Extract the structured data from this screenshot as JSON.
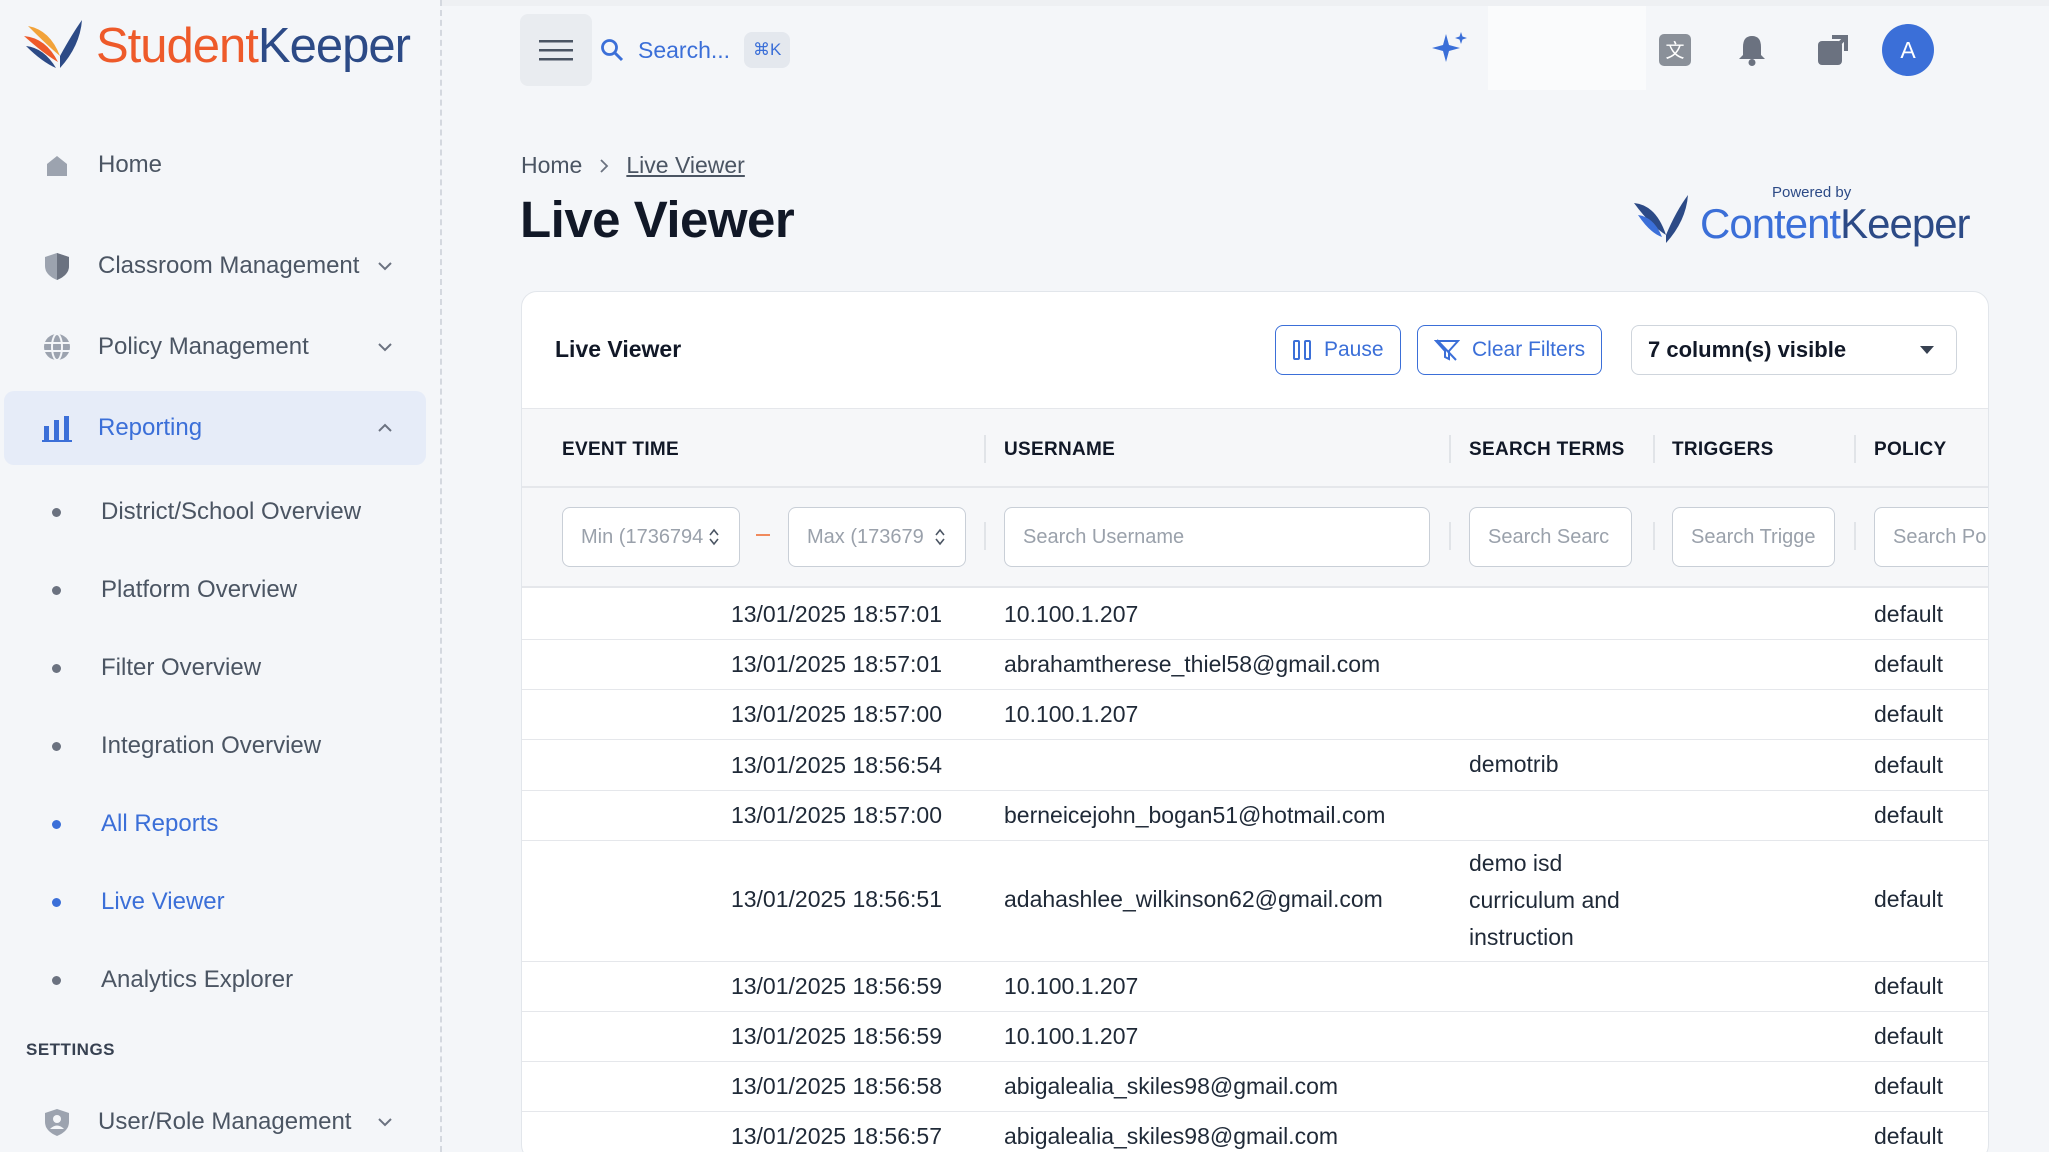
{
  "brand": {
    "logo_part1": "Student",
    "logo_part2": "Keeper"
  },
  "sidebar": {
    "items": [
      {
        "label": "Home"
      },
      {
        "label": "Classroom Management"
      },
      {
        "label": "Policy Management"
      },
      {
        "label": "Reporting"
      }
    ],
    "reporting_sub": [
      {
        "label": "District/School Overview"
      },
      {
        "label": "Platform Overview"
      },
      {
        "label": "Filter Overview"
      },
      {
        "label": "Integration Overview"
      },
      {
        "label": "All Reports"
      },
      {
        "label": "Live Viewer"
      },
      {
        "label": "Analytics Explorer"
      }
    ],
    "settings_label": "SETTINGS",
    "settings_items": [
      {
        "label": "User/Role Management"
      }
    ]
  },
  "topbar": {
    "search_placeholder": "Search...",
    "shortcut": "⌘K",
    "avatar_initial": "A"
  },
  "breadcrumb": {
    "home": "Home",
    "current": "Live Viewer"
  },
  "page_title": "Live Viewer",
  "partner_logo": {
    "powered_by": "Powered by",
    "name_part1": "Content",
    "name_part2": "Keeper"
  },
  "card": {
    "title": "Live Viewer",
    "pause_label": "Pause",
    "clear_filters_label": "Clear Filters",
    "columns_visible": "7 column(s) visible"
  },
  "table": {
    "headers": {
      "event_time": "EVENT TIME",
      "username": "USERNAME",
      "search_terms": "SEARCH TERMS",
      "triggers": "TRIGGERS",
      "policy": "POLICY"
    },
    "filters": {
      "min_placeholder": "Min (1736794",
      "max_placeholder": "Max (173679",
      "username_placeholder": "Search Username",
      "search_terms_placeholder": "Search Searc",
      "triggers_placeholder": "Search Trigge",
      "policy_placeholder": "Search Po"
    },
    "rows": [
      {
        "time": "13/01/2025 18:57:01",
        "username": "10.100.1.207",
        "search_terms": "",
        "policy": "default"
      },
      {
        "time": "13/01/2025 18:57:01",
        "username": "abrahamtherese_thiel58@gmail.com",
        "search_terms": "",
        "policy": "default"
      },
      {
        "time": "13/01/2025 18:57:00",
        "username": "10.100.1.207",
        "search_terms": "",
        "policy": "default"
      },
      {
        "time": "13/01/2025 18:56:54",
        "username": "",
        "search_terms": "demotrib",
        "policy": "default"
      },
      {
        "time": "13/01/2025 18:57:00",
        "username": "berneicejohn_bogan51@hotmail.com",
        "search_terms": "",
        "policy": "default"
      },
      {
        "time": "13/01/2025 18:56:51",
        "username": "adahashlee_wilkinson62@gmail.com",
        "search_terms": "demo isd curriculum and instruction",
        "policy": "default"
      },
      {
        "time": "13/01/2025 18:56:59",
        "username": "10.100.1.207",
        "search_terms": "",
        "policy": "default"
      },
      {
        "time": "13/01/2025 18:56:59",
        "username": "10.100.1.207",
        "search_terms": "",
        "policy": "default"
      },
      {
        "time": "13/01/2025 18:56:58",
        "username": "abigalealia_skiles98@gmail.com",
        "search_terms": "",
        "policy": "default"
      },
      {
        "time": "13/01/2025 18:56:57",
        "username": "abigalealia_skiles98@gmail.com",
        "search_terms": "",
        "policy": "default"
      }
    ]
  }
}
